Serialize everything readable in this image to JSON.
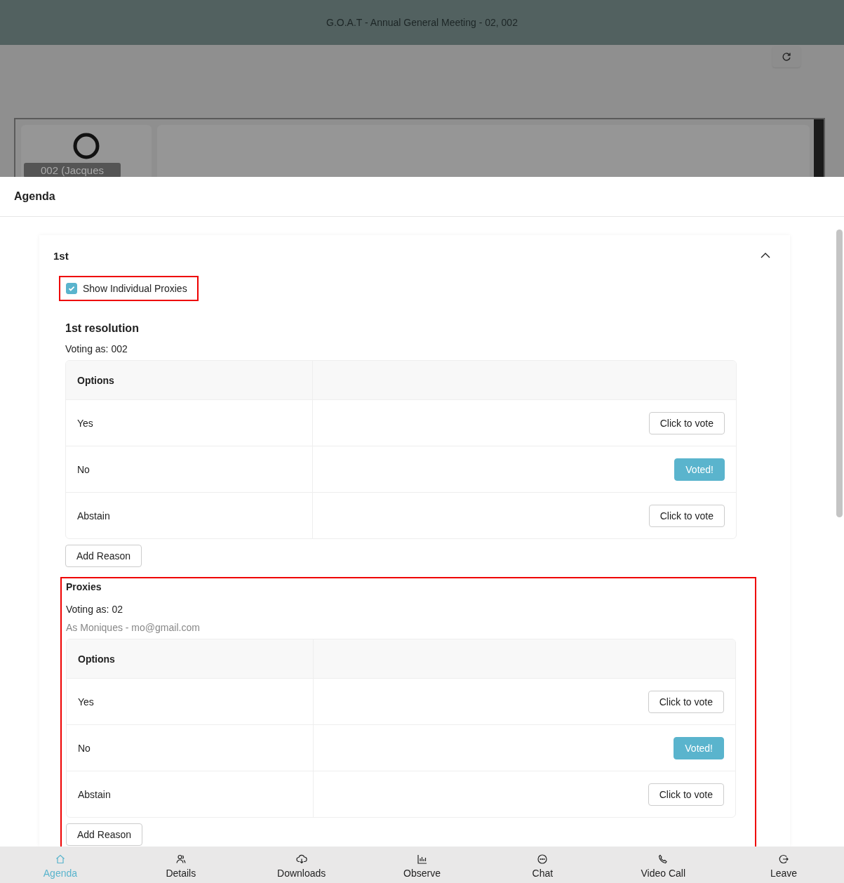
{
  "header": {
    "title": "G.O.A.T - Annual General Meeting - 02, 002"
  },
  "video": {
    "tiles": [
      {
        "kind": "participant",
        "label": "002 (Jacques"
      },
      {
        "kind": "empty"
      }
    ]
  },
  "sheet": {
    "title": "Agenda"
  },
  "agenda_item": {
    "title": "1st",
    "expanded": true,
    "show_proxies": {
      "label": "Show Individual Proxies",
      "checked": true,
      "highlighted": true
    },
    "resolution": {
      "title": "1st resolution",
      "voting_as": "Voting as: 002",
      "column_header": "Options",
      "options": [
        {
          "label": "Yes",
          "voted": false,
          "button": "Click to vote"
        },
        {
          "label": "No",
          "voted": true,
          "button": "Voted!"
        },
        {
          "label": "Abstain",
          "voted": false,
          "button": "Click to vote"
        }
      ],
      "add_reason": "Add Reason"
    },
    "proxies": {
      "title": "Proxies",
      "highlighted": true,
      "voting_as": "Voting as: 02",
      "subtitle": "As Moniques - mo@gmail.com",
      "column_header": "Options",
      "options": [
        {
          "label": "Yes",
          "voted": false,
          "button": "Click to vote"
        },
        {
          "label": "No",
          "voted": true,
          "button": "Voted!"
        },
        {
          "label": "Abstain",
          "voted": false,
          "button": "Click to vote"
        }
      ],
      "add_reason": "Add Reason"
    }
  },
  "nav": [
    {
      "label": "Agenda",
      "selected": true
    },
    {
      "label": "Details",
      "selected": false
    },
    {
      "label": "Downloads",
      "selected": false
    },
    {
      "label": "Observe",
      "selected": false
    },
    {
      "label": "Chat",
      "selected": false
    },
    {
      "label": "Video Call",
      "selected": false
    },
    {
      "label": "Leave",
      "selected": false
    }
  ]
}
